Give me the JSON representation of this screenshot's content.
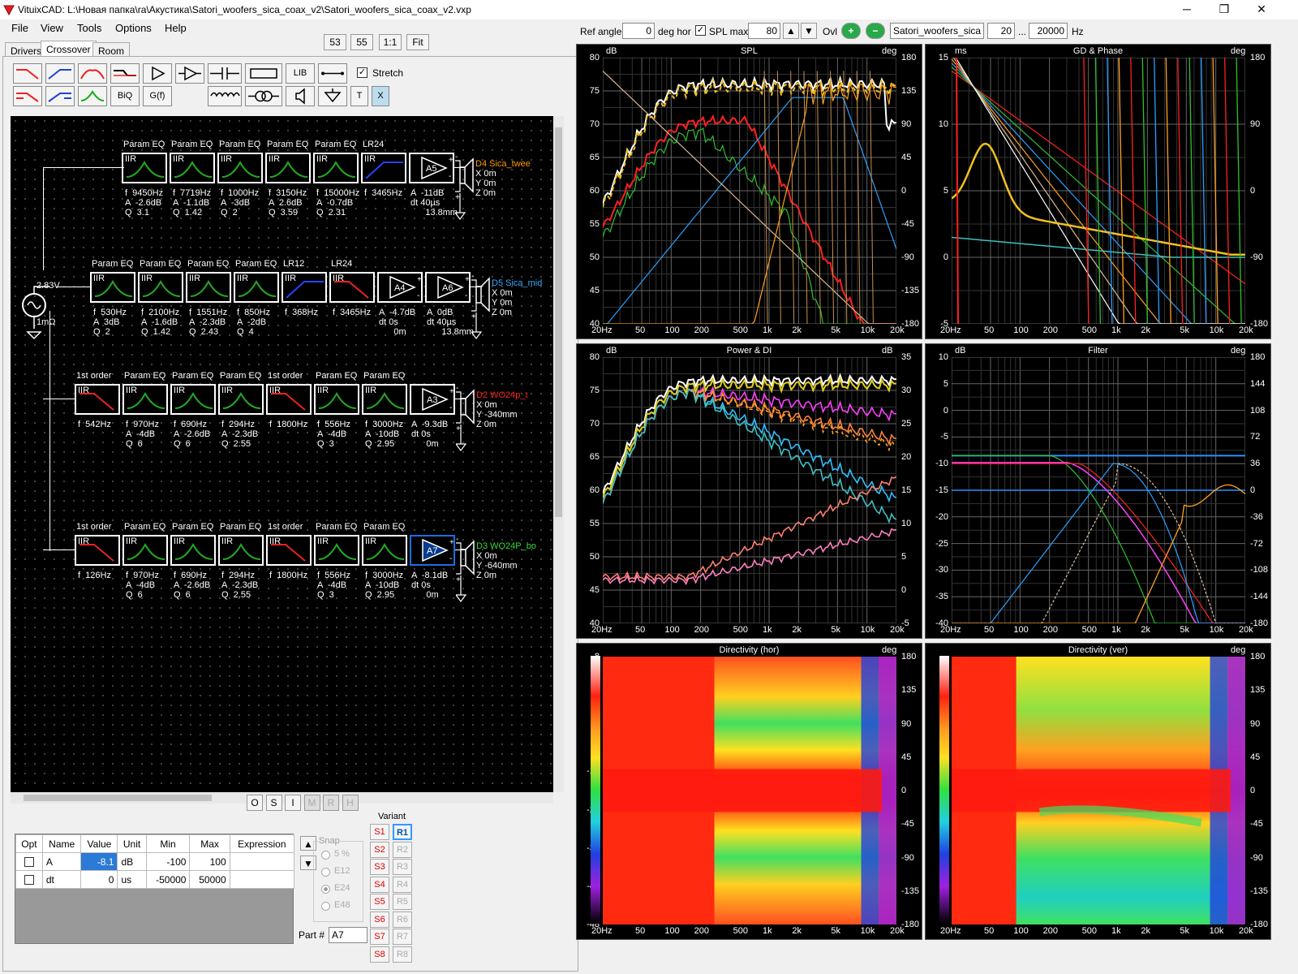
{
  "window": {
    "title": "VituixCAD: L:\\Новая папка\\ra\\Акустика\\Satori_woofers_sica_coax_v2\\Satori_woofers_sica_coax_v2.vxp",
    "minimize": "─",
    "maximize": "❐",
    "close": "✕"
  },
  "menu": [
    "File",
    "View",
    "Tools",
    "Options",
    "Help"
  ],
  "tabs": [
    "Drivers",
    "Crossover",
    "Room"
  ],
  "view_buttons": [
    "53",
    "55",
    "1:1",
    "Fit"
  ],
  "toolbar": {
    "lib": "LIB",
    "biq": "BiQ",
    "gf": "G(f)",
    "stretch": "Stretch",
    "t": "T",
    "x": "X"
  },
  "schematic": {
    "source": {
      "voltage": "2.83V",
      "impedance": "1mΩ"
    },
    "rows": [
      {
        "labels": [
          "Param EQ",
          "Param EQ",
          "Param EQ",
          "Param EQ",
          "Param EQ",
          "LR24"
        ],
        "params": [
          "f  9450Hz\nA  -2.6dB\nQ  3.1",
          "f  7719Hz\nA  -1.1dB\nQ  1.42",
          "f  1000Hz\nA  -3dB\nQ  2",
          "f  3150Hz\nA  2.6dB\nQ  3.59",
          "f  15000Hz\nA  -0.7dB\nQ  2.31",
          "f  3465Hz"
        ],
        "amp": "A5",
        "amp_params": "A  -11dB\ndt 40µs\n      13.8mm",
        "driver": {
          "name": "D4 Sica_twee",
          "pos": "X 0m\nY 0m\nZ 0m",
          "color": "#ff9900"
        }
      },
      {
        "labels": [
          "Param EQ",
          "Param EQ",
          "Param EQ",
          "Param EQ",
          "LR12",
          "LR24"
        ],
        "params": [
          "f  530Hz\nA  3dB\nQ  2",
          "f  2100Hz\nA  -1.6dB\nQ  1.42",
          "f  1551Hz\nA  -2.3dB\nQ  2.43",
          "f  850Hz\nA  -2dB\nQ  4",
          "f  368Hz",
          "f  3465Hz"
        ],
        "amps": [
          "A4",
          "A6"
        ],
        "amp_params": [
          "A  -4.7dB\ndt 0s\n      0m",
          "A  0dB\ndt 40µs\n      13.8mm"
        ],
        "driver": {
          "name": "D5 Sica_mid",
          "pos": "X 0m\nY 0m\nZ 0m",
          "color": "#33aaff"
        }
      },
      {
        "labels": [
          "1st order",
          "Param EQ",
          "Param EQ",
          "Param EQ",
          "1st order",
          "Param EQ",
          "Param EQ"
        ],
        "params": [
          "f  542Hz",
          "f  970Hz\nA  -4dB\nQ  6",
          "f  690Hz\nA  -2.6dB\nQ  6",
          "f  294Hz\nA  -2.3dB\nQ  2.55",
          "f  1800Hz",
          "f  556Hz\nA  -4dB\nQ  3",
          "f  3000Hz\nA  -10dB\nQ  2.95"
        ],
        "amp": "A3",
        "amp_params": "A  -9.3dB\ndt 0s\n      0m",
        "driver": {
          "name": "D2 WO24p_t",
          "pos": "X 0m\nY -340mm\nZ 0m",
          "color": "#ff2222"
        }
      },
      {
        "labels": [
          "1st order",
          "Param EQ",
          "Param EQ",
          "Param EQ",
          "1st order",
          "Param EQ",
          "Param EQ"
        ],
        "params": [
          "f  126Hz",
          "f  970Hz\nA  -4dB\nQ  6",
          "f  690Hz\nA  -2.6dB\nQ  6",
          "f  294Hz\nA  -2.3dB\nQ  2.55",
          "f  1800Hz",
          "f  556Hz\nA  -4dB\nQ  3",
          "f  3000Hz\nA  -10dB\nQ  2.95"
        ],
        "amp": "A7",
        "amp_params": "A  -8.1dB\ndt 0s\n      0m",
        "driver": {
          "name": "D3 WO24P_bo",
          "pos": "X 0m\nY -640mm\nZ 0m",
          "color": "#33dd33"
        }
      }
    ],
    "block_label": "IIR"
  },
  "under_buttons": [
    "O",
    "S",
    "I",
    "M",
    "R",
    "H"
  ],
  "param_grid": {
    "headers": [
      "Opt",
      "Name",
      "Value",
      "Unit",
      "Min",
      "Max",
      "Expression"
    ],
    "rows": [
      [
        "",
        "A",
        "-8.1",
        "dB",
        "-100",
        "100",
        ""
      ],
      [
        "",
        "dt",
        "0",
        "us",
        "-50000",
        "50000",
        ""
      ]
    ]
  },
  "snap": {
    "title": "Snap",
    "options": [
      "5 %",
      "E12",
      "E24",
      "E48"
    ]
  },
  "variant": {
    "title": "Variant",
    "s": [
      "S1",
      "S2",
      "S3",
      "S4",
      "S5",
      "S6",
      "S7",
      "S8"
    ],
    "r": [
      "R1",
      "R2",
      "R3",
      "R4",
      "R5",
      "R6",
      "R7",
      "R8"
    ]
  },
  "part": {
    "label": "Part #",
    "value": "A7"
  },
  "topbar": {
    "ref_angle_label": "Ref angle",
    "ref_angle": "0",
    "deg_hor": "deg hor",
    "spl_max_label": "SPL max",
    "spl_max": "80",
    "ovl": "Ovl",
    "file": "Satori_woofers_sica_co",
    "f_from": "20",
    "dots": "...",
    "f_to": "20000",
    "hz": "Hz"
  },
  "xticks": [
    "20Hz",
    "50",
    "100",
    "200",
    "500",
    "1k",
    "2k",
    "5k",
    "10k",
    "20k"
  ],
  "graphs": {
    "spl": {
      "title": "SPL",
      "lunit": "dB",
      "runit": "deg",
      "left": [
        "80",
        "75",
        "70",
        "65",
        "60",
        "55",
        "50",
        "45",
        "40"
      ],
      "right": [
        "180",
        "135",
        "90",
        "45",
        "0",
        "-45",
        "-90",
        "-135",
        "-180"
      ]
    },
    "gd": {
      "title": "GD & Phase",
      "lunit": "ms",
      "runit": "deg",
      "left": [
        "15",
        "10",
        "5",
        "0",
        "-5"
      ],
      "right": [
        "180",
        "90",
        "0",
        "-90",
        "-180"
      ]
    },
    "power": {
      "title": "Power & DI",
      "lunit": "dB",
      "runit": "dB",
      "left": [
        "80",
        "75",
        "70",
        "65",
        "60",
        "55",
        "50",
        "45",
        "40"
      ],
      "right": [
        "35",
        "30",
        "25",
        "20",
        "15",
        "10",
        "5",
        "0",
        "-5"
      ]
    },
    "filter": {
      "title": "Filter",
      "lunit": "dB",
      "runit": "deg",
      "left": [
        "10",
        "5",
        "0",
        "-5",
        "-10",
        "-15",
        "-20",
        "-25",
        "-30",
        "-35",
        "-40"
      ],
      "right": [
        "180",
        "144",
        "108",
        "72",
        "36",
        "0",
        "-36",
        "-72",
        "-108",
        "-144",
        "-180"
      ]
    },
    "dirh": {
      "title": "Directivity (hor)",
      "runit": "deg",
      "left": [
        "8",
        "0",
        "-8",
        "-16",
        "-24",
        "-32",
        "-40",
        "-48"
      ],
      "right": [
        "180",
        "135",
        "90",
        "45",
        "0",
        "-45",
        "-90",
        "-135",
        "-180"
      ]
    },
    "dirv": {
      "title": "Directivity (ver)",
      "runit": "deg",
      "right": [
        "180",
        "135",
        "90",
        "45",
        "0",
        "-45",
        "-90",
        "-135",
        "-180"
      ]
    }
  }
}
